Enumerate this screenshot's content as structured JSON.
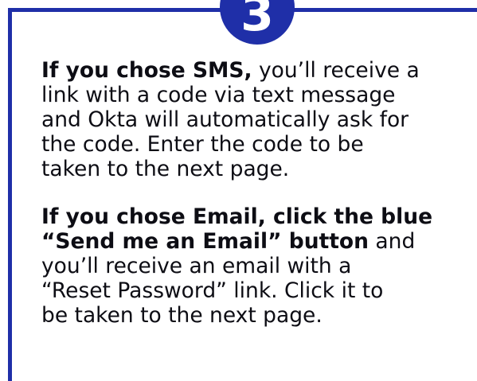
{
  "step": {
    "number": "3"
  },
  "paragraphs": [
    {
      "lead": "If you chose SMS,",
      "body": " you’ll receive a\nlink with a code via text message\nand Okta will automatically ask for\nthe code. Enter the code to be\ntaken to the next page."
    },
    {
      "lead": "If you chose Email, click the blue\n“Send me an Email” button",
      "body": " and\nyou’ll receive an email with a\n“Reset Password” link. Click it to\nbe taken to the next page."
    }
  ],
  "colors": {
    "accent": "#1f2fa8",
    "text": "#0d0d14",
    "background": "#ffffff"
  }
}
